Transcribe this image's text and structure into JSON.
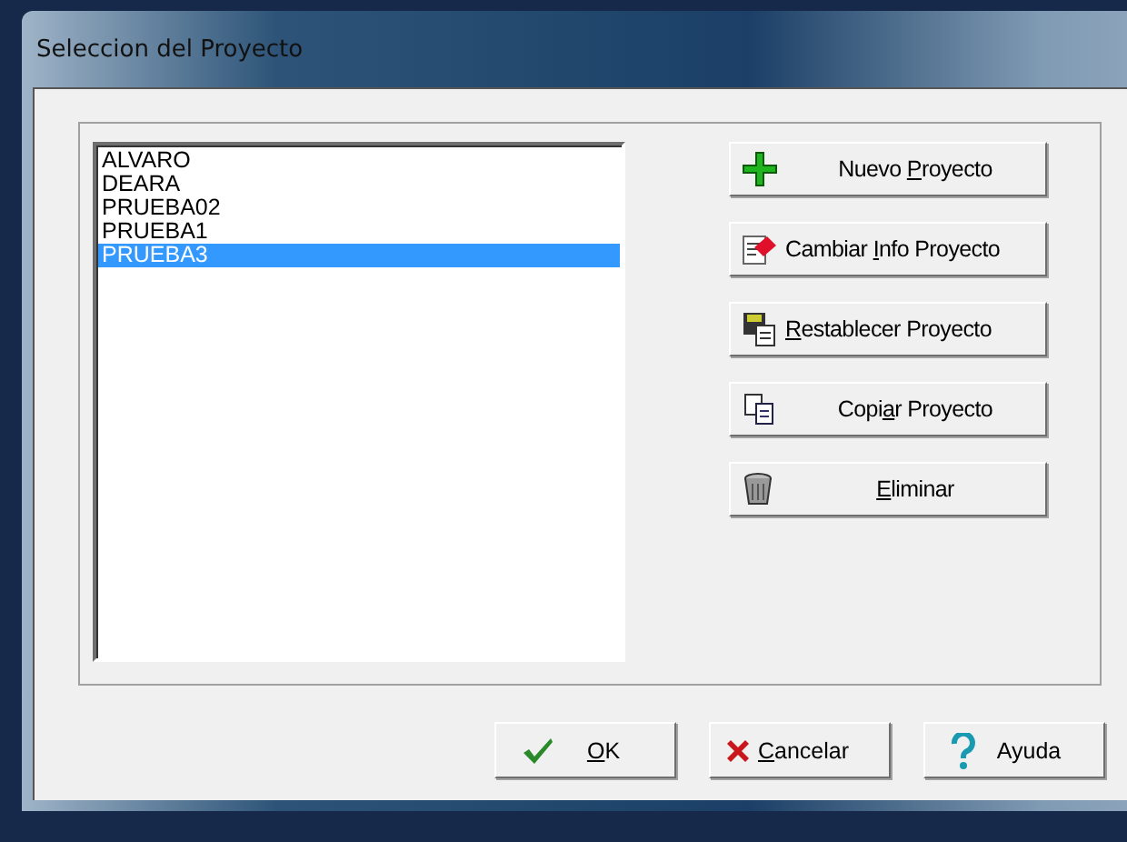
{
  "window": {
    "title": "Seleccion del Proyecto"
  },
  "projects": [
    {
      "label": "ALVARO",
      "selected": false
    },
    {
      "label": "DEARA",
      "selected": false
    },
    {
      "label": "PRUEBA02",
      "selected": false
    },
    {
      "label": "PRUEBA1",
      "selected": false
    },
    {
      "label": "PRUEBA3",
      "selected": true
    }
  ],
  "actions": [
    {
      "kind": "new",
      "pre": "Nuevo ",
      "key": "P",
      "post": "royecto"
    },
    {
      "kind": "edit",
      "pre": "Cambiar ",
      "key": "I",
      "post": "nfo Proyecto"
    },
    {
      "kind": "restore",
      "key": "R",
      "post": "establecer Proyecto"
    },
    {
      "kind": "copy",
      "pre": "Copi",
      "key": "a",
      "post": "r Proyecto"
    },
    {
      "kind": "delete",
      "key": "E",
      "post": "liminar"
    }
  ],
  "buttons": [
    {
      "kind": "ok",
      "key": "O",
      "post": "K"
    },
    {
      "kind": "cancel",
      "key": "C",
      "post": "ancelar"
    },
    {
      "kind": "help",
      "pre": "Ayuda"
    }
  ]
}
